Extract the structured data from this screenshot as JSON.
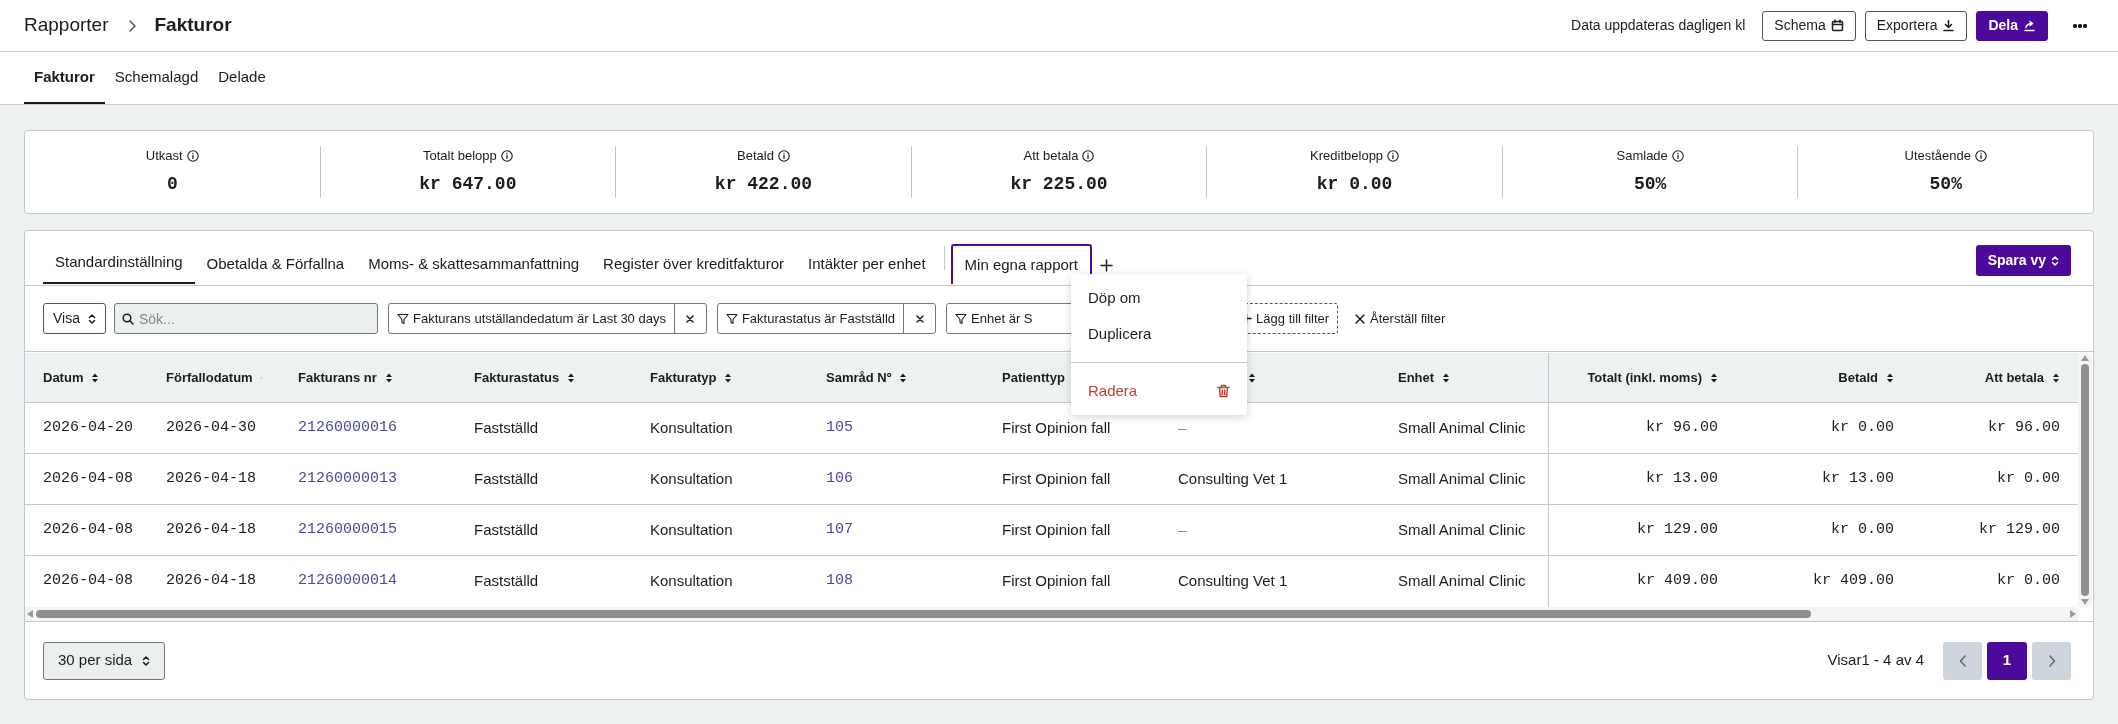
{
  "breadcrumb": [
    "Rapporter",
    "Fakturor"
  ],
  "header_note": "Data uppdateras dagligen kl",
  "header_buttons": [
    {
      "label": "Schema",
      "kind": "outline"
    },
    {
      "label": "Exportera",
      "kind": "outline"
    },
    {
      "label": "Dela",
      "kind": "primary"
    }
  ],
  "page_tabs": [
    {
      "label": "Fakturor",
      "selected": true
    },
    {
      "label": "Schemalagd",
      "selected": false
    },
    {
      "label": "Delade",
      "selected": false
    }
  ],
  "stats": [
    {
      "label": "Utkast",
      "value": "0"
    },
    {
      "label": "Totalt belopp",
      "value": "kr 647.00"
    },
    {
      "label": "Betald",
      "value": "kr 422.00"
    },
    {
      "label": "Att betala",
      "value": "kr 225.00"
    },
    {
      "label": "Kreditbelopp",
      "value": "kr 0.00"
    },
    {
      "label": "Samlade",
      "value": "50%"
    },
    {
      "label": "Utestående",
      "value": "50%"
    }
  ],
  "report_tabs": [
    {
      "label": "Standardinställning",
      "selected": true,
      "menu_open": false
    },
    {
      "label": "Obetalda & Förfallna",
      "selected": false,
      "menu_open": false
    },
    {
      "label": "Moms- & skattesammanfattning",
      "selected": false,
      "menu_open": false
    },
    {
      "label": "Register över kreditfakturor",
      "selected": false,
      "menu_open": false
    },
    {
      "label": "Intäkter per enhet",
      "selected": false,
      "menu_open": false
    },
    {
      "label": "Min egna rapport",
      "selected": false,
      "menu_open": true
    }
  ],
  "save_view_button": "Spara vy",
  "view_select": "Visa",
  "search": {
    "placeholder": "Sök..."
  },
  "filter_chips": [
    {
      "label": "Fakturans utställandedatum är Last 30 days",
      "removable": true
    },
    {
      "label": "Fakturastatus är Fastställd",
      "removable": true
    },
    {
      "label": "Enhet är S",
      "removable": false
    }
  ],
  "add_filter": "Lägg till filter",
  "reset_filter": "Återställ filter",
  "tab_menu": [
    {
      "label": "Döp om",
      "kind": "normal"
    },
    {
      "label": "Duplicera",
      "kind": "normal"
    },
    {
      "label": "Radera",
      "kind": "danger"
    }
  ],
  "table": {
    "columns": [
      {
        "label": "Datum",
        "kind": "date"
      },
      {
        "label": "Förfallodatum",
        "kind": "date"
      },
      {
        "label": "Fakturans nr",
        "kind": "link"
      },
      {
        "label": "Fakturastatus",
        "kind": "text"
      },
      {
        "label": "Fakturatyp",
        "kind": "text"
      },
      {
        "label": "Samråd Nº",
        "kind": "link"
      },
      {
        "label": "Patienttyp",
        "kind": "text",
        "sortable": false
      },
      {
        "kind": "text"
      },
      {
        "label": "Enhet",
        "kind": "text"
      },
      {
        "label": "Totalt (inkl. moms)",
        "kind": "amount"
      },
      {
        "label": "Betald",
        "kind": "amount"
      },
      {
        "label": "Att betala",
        "kind": "amount"
      }
    ],
    "rows": [
      [
        "2026-04-20",
        "2026-04-30",
        "21260000016",
        "Fastställd",
        "Konsultation",
        "105",
        "First Opinion fall",
        "–",
        "Small Animal Clinic",
        "kr 96.00",
        "kr 0.00",
        "kr 96.00"
      ],
      [
        "2026-04-08",
        "2026-04-18",
        "21260000013",
        "Fastställd",
        "Konsultation",
        "106",
        "First Opinion fall",
        "Consulting Vet 1",
        "Small Animal Clinic",
        "kr 13.00",
        "kr 13.00",
        "kr 0.00"
      ],
      [
        "2026-04-08",
        "2026-04-18",
        "21260000015",
        "Fastställd",
        "Konsultation",
        "107",
        "First Opinion fall",
        "–",
        "Small Animal Clinic",
        "kr 129.00",
        "kr 0.00",
        "kr 129.00"
      ],
      [
        "2026-04-08",
        "2026-04-18",
        "21260000014",
        "Fastställd",
        "Konsultation",
        "108",
        "First Opinion fall",
        "Consulting Vet 1",
        "Small Animal Clinic",
        "kr 409.00",
        "kr 409.00",
        "kr 0.00"
      ]
    ]
  },
  "per_page": "30 per sida",
  "showing": "Visar1 - 4 av 4",
  "pages": [
    {
      "label": "1",
      "selected": true
    }
  ]
}
